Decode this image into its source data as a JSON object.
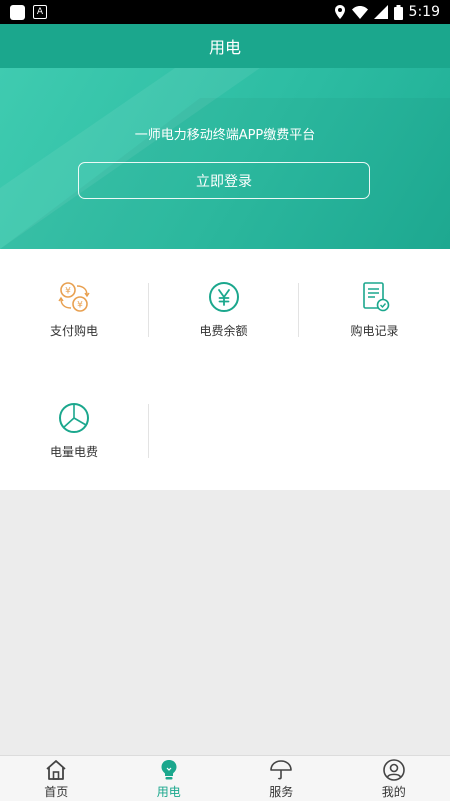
{
  "status_bar": {
    "time": "5:19"
  },
  "header": {
    "title": "用电"
  },
  "hero": {
    "subtitle": "一师电力移动终端APP缴费平台",
    "login_label": "立即登录"
  },
  "grid_row1": [
    {
      "label": "支付购电",
      "icon": "exchange-coins-icon"
    },
    {
      "label": "电费余额",
      "icon": "yen-circle-icon"
    },
    {
      "label": "购电记录",
      "icon": "document-check-icon"
    }
  ],
  "grid_row2": [
    {
      "label": "电量电费",
      "icon": "pie-chart-icon"
    }
  ],
  "tabbar": [
    {
      "label": "首页",
      "icon": "home-icon"
    },
    {
      "label": "用电",
      "icon": "lightbulb-icon",
      "active": true
    },
    {
      "label": "服务",
      "icon": "umbrella-icon"
    },
    {
      "label": "我的",
      "icon": "user-circle-icon"
    }
  ],
  "colors": {
    "accent": "#1ba78d",
    "orange": "#e8a050"
  }
}
